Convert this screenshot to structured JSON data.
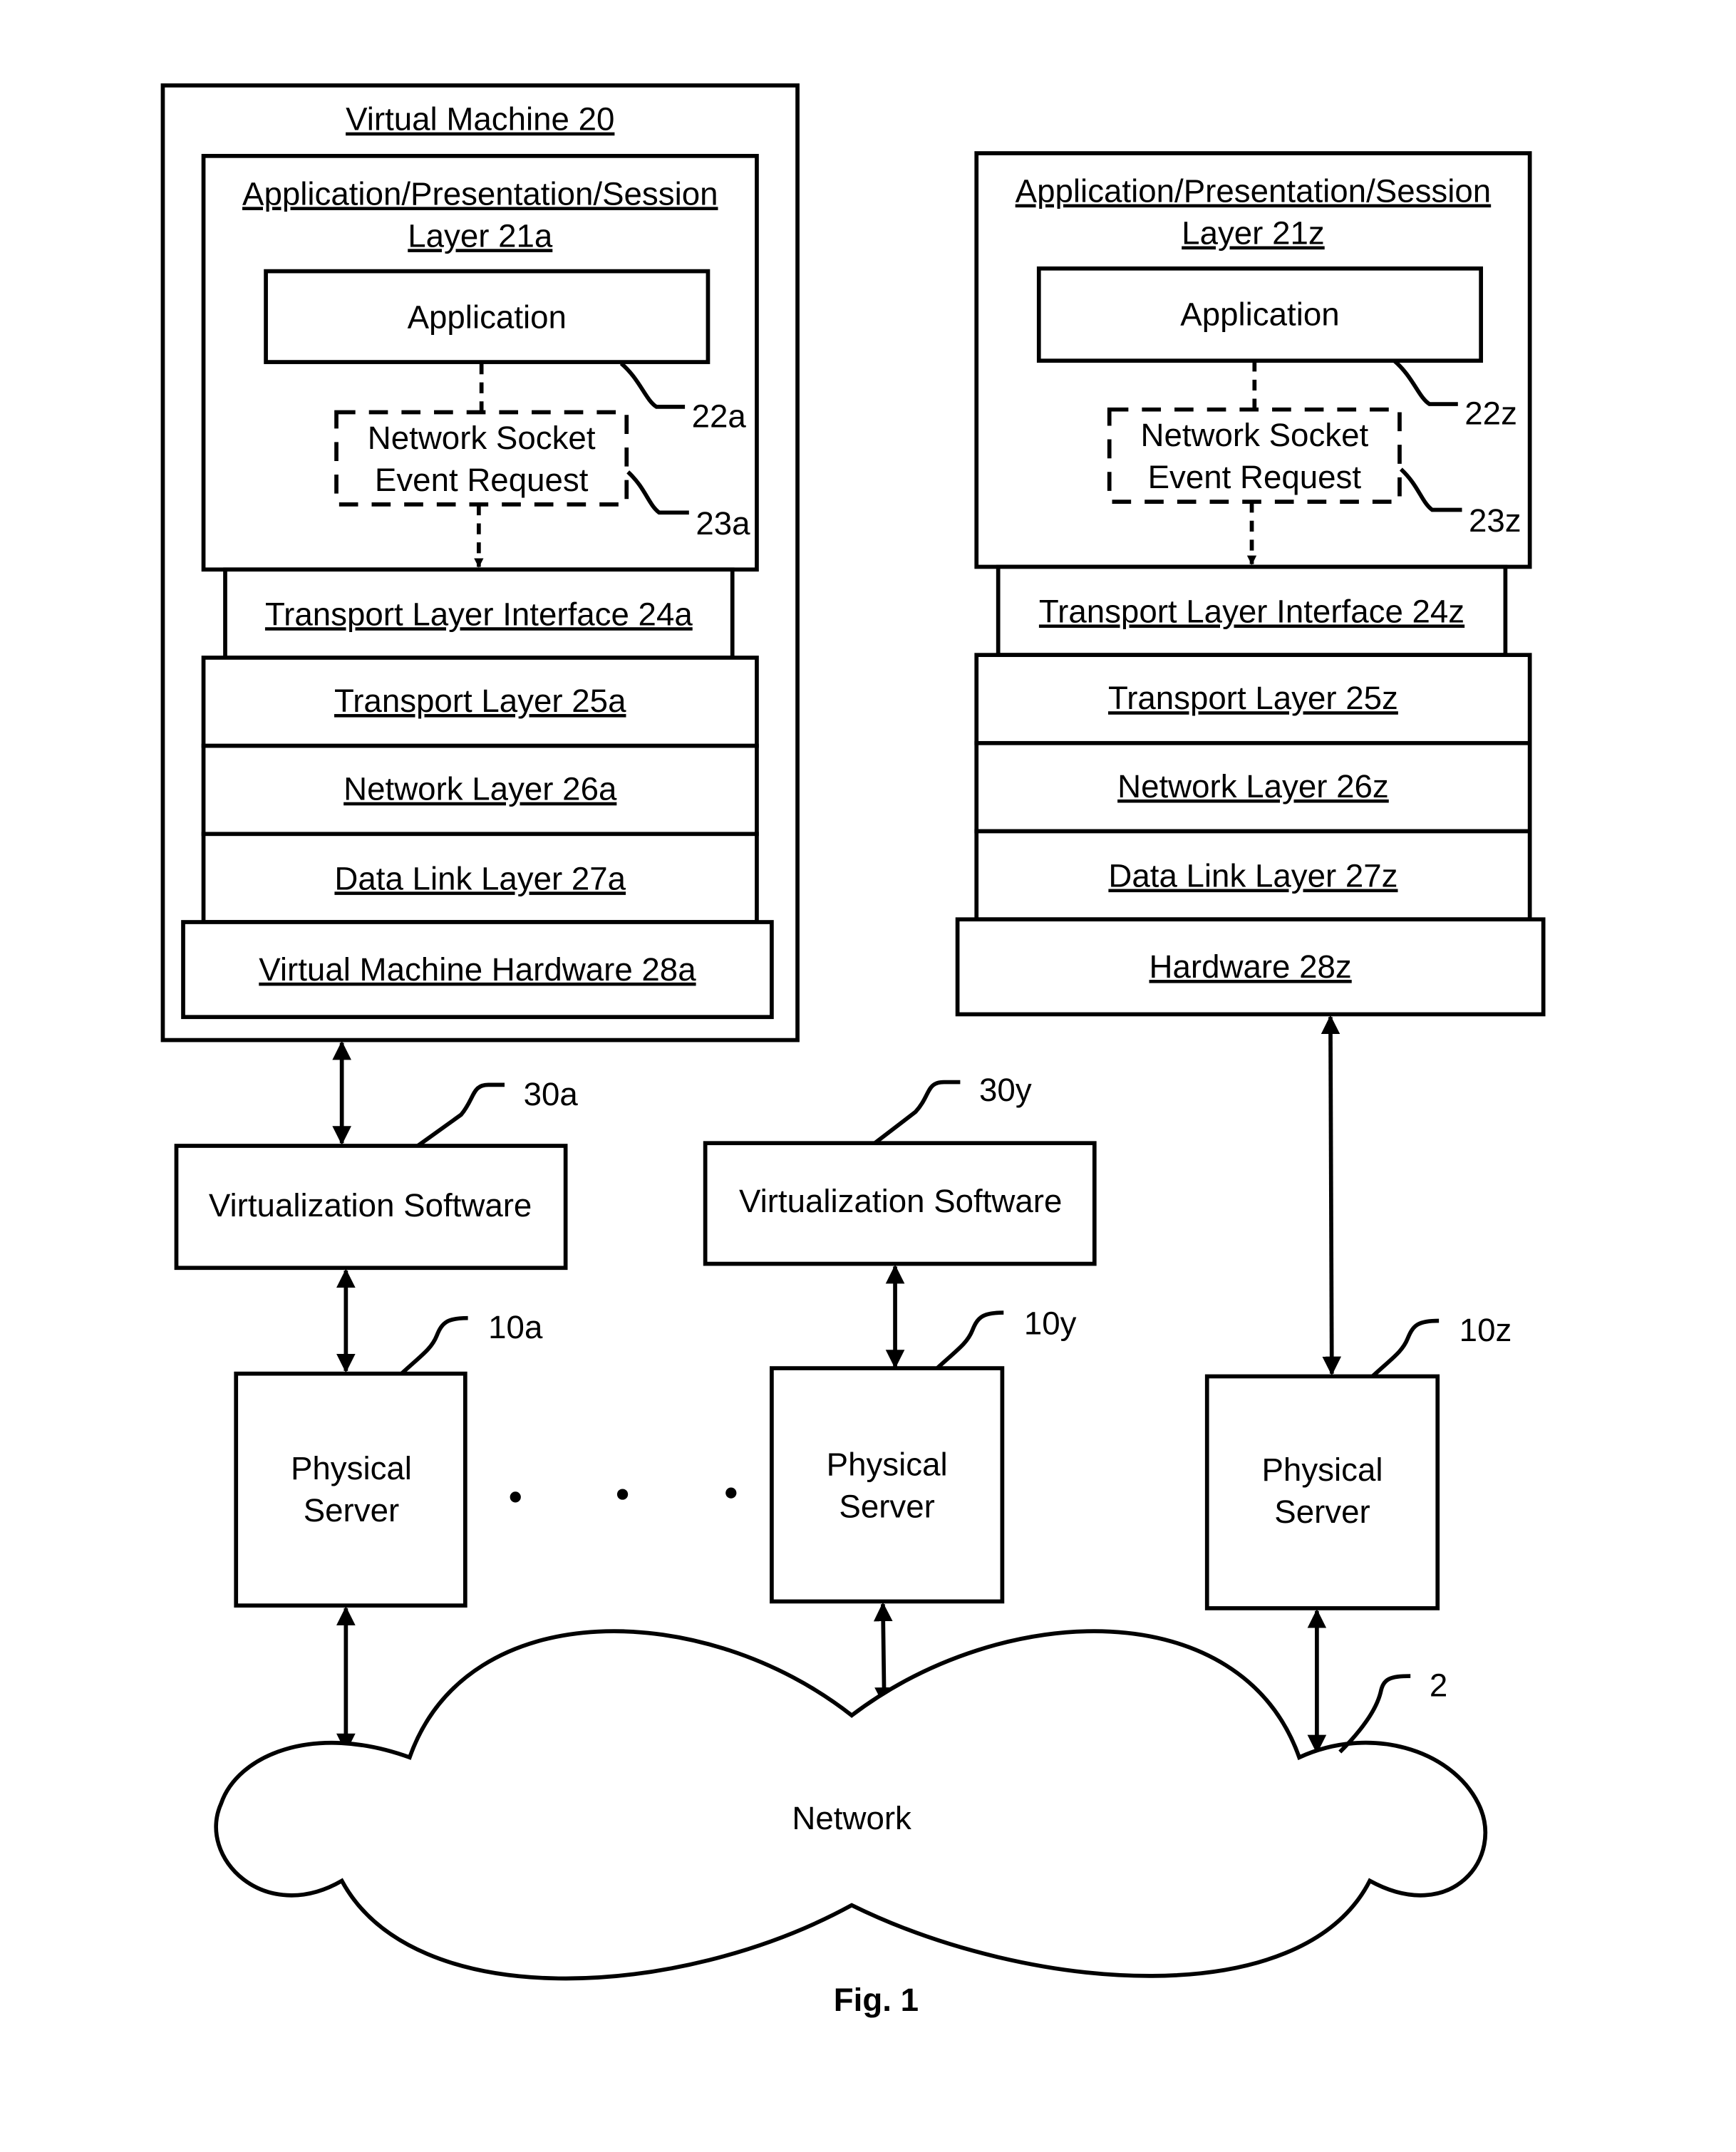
{
  "figure": {
    "caption": "Fig. 1"
  },
  "left_stack": {
    "vm_title": "Virtual Machine 20",
    "app_layer_line1": "Application/Presentation/Session",
    "app_layer_line2": "Layer 21a",
    "application_label": "Application",
    "application_ref": "22a",
    "socket_line1": "Network Socket",
    "socket_line2": "Event Request",
    "socket_ref": "23a",
    "transport_interface": "Transport Layer Interface 24a",
    "transport_layer": "Transport Layer 25a",
    "network_layer": "Network Layer 26a",
    "data_link_layer": "Data Link Layer 27a",
    "hardware": "Virtual Machine Hardware 28a"
  },
  "right_stack": {
    "app_layer_line1": "Application/Presentation/Session",
    "app_layer_line2": "Layer 21z",
    "application_label": "Application",
    "application_ref": "22z",
    "socket_line1": "Network Socket",
    "socket_line2": "Event Request",
    "socket_ref": "23z",
    "transport_interface": "Transport Layer Interface 24z",
    "transport_layer": "Transport Layer 25z",
    "network_layer": "Network Layer 26z",
    "data_link_layer": "Data Link Layer 27z",
    "hardware": "Hardware 28z"
  },
  "virtualization": [
    {
      "label": "Virtualization Software",
      "ref": "30a"
    },
    {
      "label": "Virtualization Software",
      "ref": "30y"
    }
  ],
  "servers": [
    {
      "line1": "Physical",
      "line2": "Server",
      "ref": "10a"
    },
    {
      "line1": "Physical",
      "line2": "Server",
      "ref": "10y"
    },
    {
      "line1": "Physical",
      "line2": "Server",
      "ref": "10z"
    }
  ],
  "network": {
    "label": "Network",
    "ref": "2"
  }
}
